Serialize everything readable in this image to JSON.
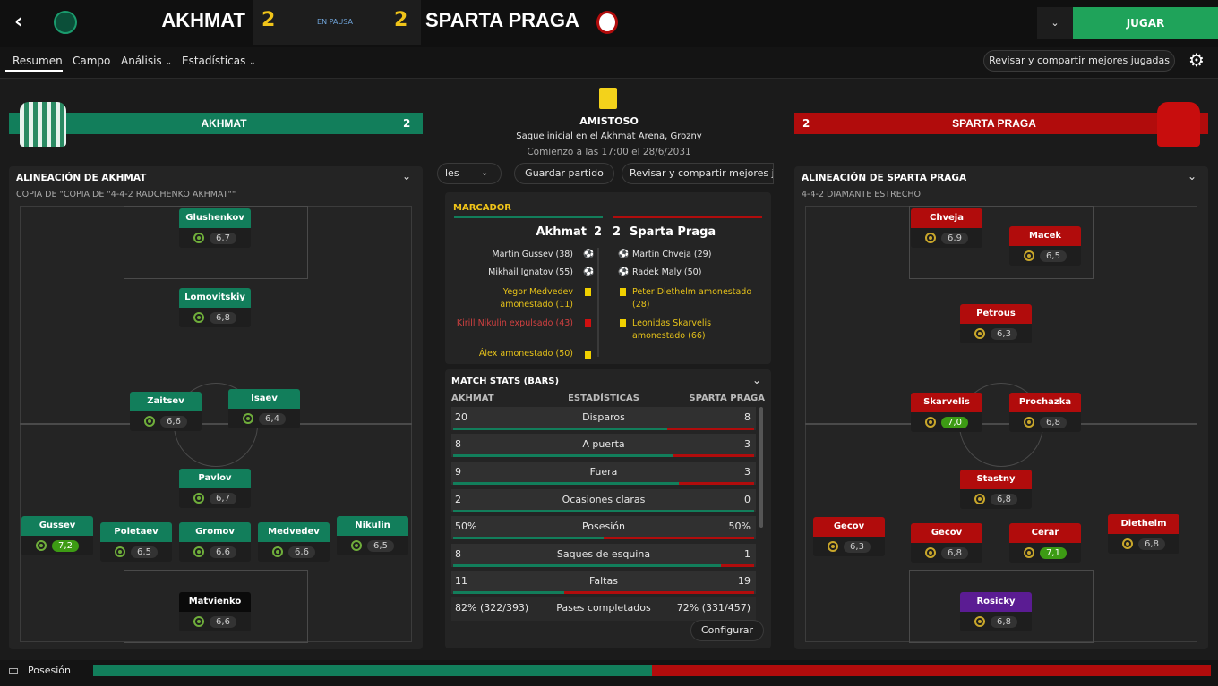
{
  "header": {
    "home": "AKHMAT",
    "home_score": "2",
    "status": "EN PAUSA",
    "away_score": "2",
    "away": "SPARTA PRAGA",
    "play_button": "JUGAR"
  },
  "tabs": [
    "Resumen",
    "Campo",
    "Análisis",
    "Estadísticas"
  ],
  "review_button": "Revisar y compartir mejores jugadas",
  "match_info": {
    "competition": "AMISTOSO",
    "venue": "Saque inicial en el Akhmat Arena, Grozny",
    "time": "Comienzo a las 17:00 el 28/6/2031",
    "left_btn": "les",
    "save": "Guardar partido",
    "review": "Revisar y compartir mejores ju"
  },
  "home_bar": {
    "name": "AKHMAT",
    "score": "2"
  },
  "away_bar": {
    "name": "SPARTA PRAGA",
    "score": "2"
  },
  "home_lineup": {
    "title": "ALINEACIÓN DE AKHMAT",
    "tactic": "COPIA DE \"COPIA DE \"4-4-2 RADCHENKO AKHMAT\"\""
  },
  "away_lineup": {
    "title": "ALINEACIÓN DE SPARTA PRAGA",
    "tactic": "4-4-2 DIAMANTE ESTRECHO"
  },
  "home_players": [
    {
      "name": "Glushenkov",
      "rating": "6,7"
    },
    {
      "name": "Lomovitskiy",
      "rating": "6,8"
    },
    {
      "name": "Zaitsev",
      "rating": "6,6"
    },
    {
      "name": "Isaev",
      "rating": "6,4"
    },
    {
      "name": "Pavlov",
      "rating": "6,7"
    },
    {
      "name": "Gussev",
      "rating": "7,2"
    },
    {
      "name": "Poletaev",
      "rating": "6,5"
    },
    {
      "name": "Gromov",
      "rating": "6,6"
    },
    {
      "name": "Medvedev",
      "rating": "6,6"
    },
    {
      "name": "Nikulin",
      "rating": "6,5"
    },
    {
      "name": "Matvienko",
      "rating": "6,6"
    }
  ],
  "away_players": [
    {
      "name": "Chveja",
      "rating": "6,9"
    },
    {
      "name": "Macek",
      "rating": "6,5"
    },
    {
      "name": "Petrous",
      "rating": "6,3"
    },
    {
      "name": "Skarvelis",
      "rating": "7,0"
    },
    {
      "name": "Prochazka",
      "rating": "6,8"
    },
    {
      "name": "Stastny",
      "rating": "6,8"
    },
    {
      "name": "Gecov",
      "rating": "6,3"
    },
    {
      "name": "Gecov",
      "rating": "6,8"
    },
    {
      "name": "Cerar",
      "rating": "7,1"
    },
    {
      "name": "Diethelm",
      "rating": "6,8"
    },
    {
      "name": "Rosicky",
      "rating": "6,8"
    }
  ],
  "scoreboard": {
    "title": "MARCADOR",
    "home": "Akhmat",
    "home_score": "2",
    "away_score": "2",
    "away": "Sparta Praga",
    "home_events": [
      "Martin Gussev (38)",
      "Mikhail Ignatov (55)",
      "Yegor Medvedev amonestado (11)",
      "Kirill Nikulin expulsado (43)",
      "Álex amonestado (50)"
    ],
    "away_events": [
      "Martin Chveja (29)",
      "Radek Maly (50)",
      "Peter Diethelm amonestado (28)",
      "Leonidas Skarvelis amonestado (66)"
    ]
  },
  "stats": {
    "title": "MATCH STATS (BARS)",
    "col_home": "AKHMAT",
    "col_mid": "ESTADÍSTICAS",
    "col_away": "SPARTA PRAGA",
    "rows": [
      {
        "label": "Disparos",
        "home": "20",
        "away": "8",
        "share": 0.71
      },
      {
        "label": "A puerta",
        "home": "8",
        "away": "3",
        "share": 0.73
      },
      {
        "label": "Fuera",
        "home": "9",
        "away": "3",
        "share": 0.75
      },
      {
        "label": "Ocasiones claras",
        "home": "2",
        "away": "0",
        "share": 1.0
      },
      {
        "label": "Posesión",
        "home": "50%",
        "away": "50%",
        "share": 0.5
      },
      {
        "label": "Saques de esquina",
        "home": "8",
        "away": "1",
        "share": 0.89
      },
      {
        "label": "Faltas",
        "home": "11",
        "away": "19",
        "share": 0.37
      }
    ],
    "passes": {
      "label": "Pases completados",
      "home": "82% (322/393)",
      "away": "72% (331/457)"
    },
    "configure": "Configurar"
  },
  "footer": {
    "label": "Posesión",
    "home_share": 0.5
  }
}
